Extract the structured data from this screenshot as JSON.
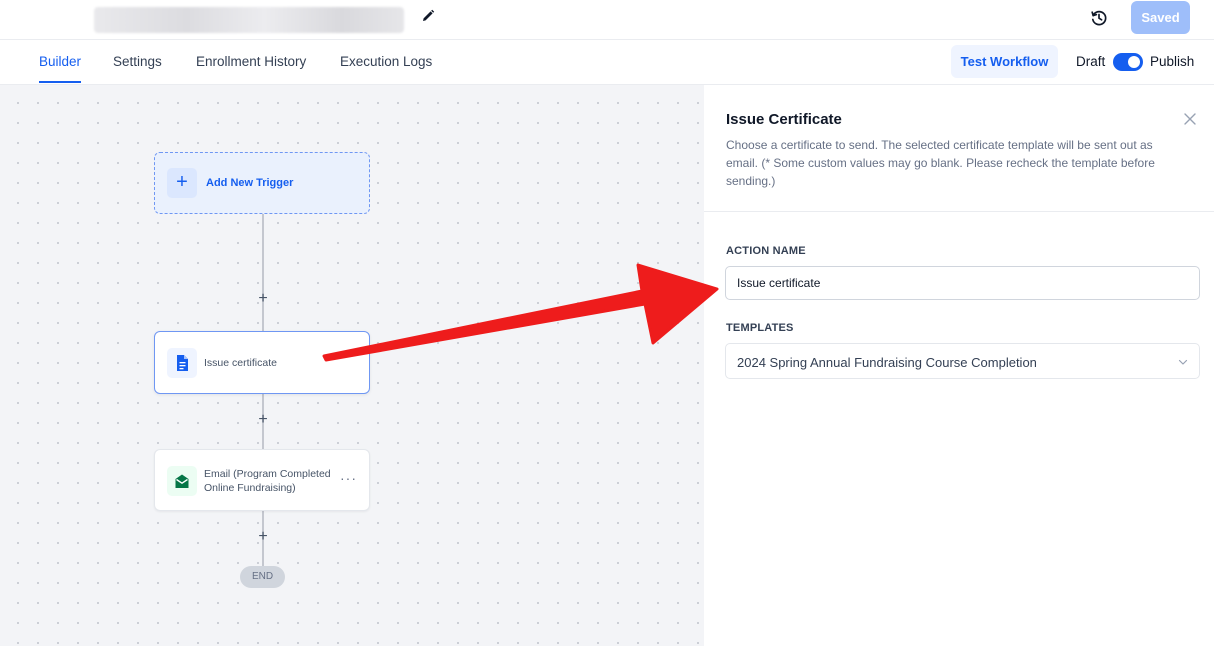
{
  "header": {
    "workflow_name": "",
    "pencil_icon": "pencil-icon",
    "history_icon": "history-icon",
    "saved_label": "Saved"
  },
  "tabs": [
    {
      "label": "Builder",
      "active": true
    },
    {
      "label": "Settings",
      "active": false
    },
    {
      "label": "Enrollment History",
      "active": false
    },
    {
      "label": "Execution Logs",
      "active": false
    }
  ],
  "toolbar": {
    "test_label": "Test Workflow",
    "draft_label": "Draft",
    "publish_label": "Publish",
    "publish_on": true
  },
  "canvas": {
    "trigger_label": "Add New Trigger",
    "nodes": [
      {
        "label": "Issue certificate",
        "icon": "document-icon"
      },
      {
        "label": "Email (Program Completed Online Fundraising)",
        "icon": "email-icon"
      }
    ],
    "plus_symbol": "+",
    "end_label": "END",
    "menu_symbol": "···"
  },
  "panel": {
    "title": "Issue Certificate",
    "description": "Choose a certificate to send. The selected certificate template will be sent out as email. (* Some custom values may go blank. Please recheck the template before sending.)",
    "action_name_label": "ACTION NAME",
    "action_name_value": "Issue certificate",
    "templates_label": "TEMPLATES",
    "template_value": "2024 Spring Annual Fundraising Course Completion"
  },
  "colors": {
    "accent": "#155eef",
    "saved_bg": "#9ebefa",
    "annotation_arrow": "#ee1c1c",
    "email_icon": "#067647"
  }
}
